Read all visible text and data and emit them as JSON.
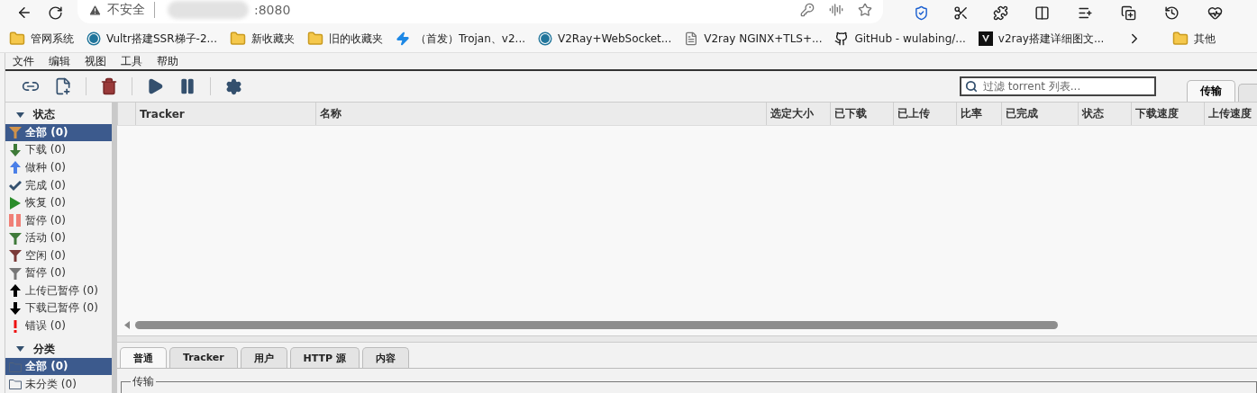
{
  "browser": {
    "security_label": "不安全",
    "address": ":8080",
    "bookmarks": [
      {
        "label": "管网系统",
        "kind": "folder"
      },
      {
        "label": "Vultr搭建SSR梯子-2...",
        "kind": "site"
      },
      {
        "label": "新收藏夹",
        "kind": "folder"
      },
      {
        "label": "旧的收藏夹",
        "kind": "folder"
      },
      {
        "label": "（首发）Trojan、v2...",
        "kind": "bolt"
      },
      {
        "label": "V2Ray+WebSocket...",
        "kind": "site"
      },
      {
        "label": "V2ray NGINX+TLS+...",
        "kind": "page"
      },
      {
        "label": "GitHub - wulabing/...",
        "kind": "github"
      },
      {
        "label": "v2ray搭建详细图文...",
        "kind": "dark"
      }
    ],
    "other_folder": "其他"
  },
  "menu": [
    "文件",
    "编辑",
    "视图",
    "工具",
    "帮助"
  ],
  "search": {
    "placeholder": "过滤 torrent 列表..."
  },
  "right_tabs": [
    {
      "label": "传输",
      "selected": true
    }
  ],
  "sidebar": [
    {
      "title": "状态",
      "expanded": true,
      "items": [
        {
          "label": "全部 (0)",
          "kind": "filter",
          "color": "#d0924a",
          "selected": true
        },
        {
          "label": "下载 (0)",
          "kind": "down",
          "color": "#3e7a38",
          "selected": false
        },
        {
          "label": "做种 (0)",
          "kind": "up",
          "color": "#4a7fe8",
          "selected": false
        },
        {
          "label": "完成 (0)",
          "kind": "check",
          "color": "#34506e",
          "selected": false
        },
        {
          "label": "恢复 (0)",
          "kind": "play",
          "color": "#2a8c2a",
          "selected": false
        },
        {
          "label": "暂停 (0)",
          "kind": "pause",
          "color": "#f07f76",
          "selected": false
        },
        {
          "label": "活动 (0)",
          "kind": "filter",
          "color": "#3f7a3a",
          "selected": false
        },
        {
          "label": "空闲 (0)",
          "kind": "filter",
          "color": "#7a3a38",
          "selected": false
        },
        {
          "label": "暂停 (0)",
          "kind": "filter",
          "color": "#777777",
          "selected": false
        },
        {
          "label": "上传已暂停 (0)",
          "kind": "up",
          "color": "#000000",
          "selected": false
        },
        {
          "label": "下载已暂停 (0)",
          "kind": "down",
          "color": "#000000",
          "selected": false
        },
        {
          "label": "错误 (0)",
          "kind": "error",
          "color": "#ee1111",
          "selected": false
        }
      ]
    },
    {
      "title": "分类",
      "expanded": true,
      "items": [
        {
          "label": "全部 (0)",
          "kind": "folder",
          "color": "#52637a",
          "selected": true
        },
        {
          "label": "未分类 (0)",
          "kind": "folder",
          "color": "#52637a",
          "selected": false
        }
      ]
    }
  ],
  "table": {
    "columns": [
      "Tracker",
      "名称",
      "选定大小",
      "已下载",
      "已上传",
      "比率",
      "已完成",
      "状态",
      "下载速度",
      "上传速度"
    ]
  },
  "details": {
    "tabs": [
      {
        "label": "普通",
        "selected": true
      },
      {
        "label": "Tracker",
        "selected": false
      },
      {
        "label": "用户",
        "selected": false
      },
      {
        "label": "HTTP 源",
        "selected": false
      },
      {
        "label": "内容",
        "selected": false
      }
    ],
    "group_title": "传输"
  }
}
